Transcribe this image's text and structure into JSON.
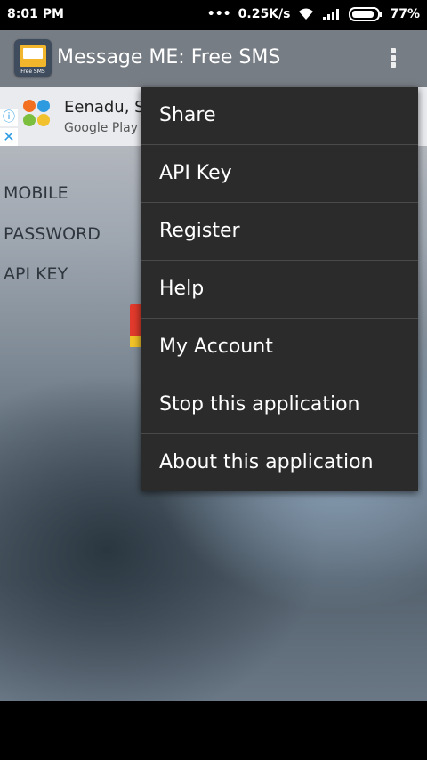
{
  "status_bar": {
    "time": "8:01 PM",
    "network_speed": "0.25K/s",
    "battery": "77%"
  },
  "app_bar": {
    "title": "Message ME: Free SMS",
    "icon_label": "Free SMS"
  },
  "ad": {
    "title": "Eenadu, S",
    "subtitle": "Google Play"
  },
  "form": {
    "labels": [
      "MOBILE",
      "PASSWORD",
      "API KEY"
    ]
  },
  "menu": {
    "items": [
      "Share",
      "API Key",
      "Register",
      "Help",
      "My Account",
      "Stop this application",
      "About this application"
    ]
  }
}
